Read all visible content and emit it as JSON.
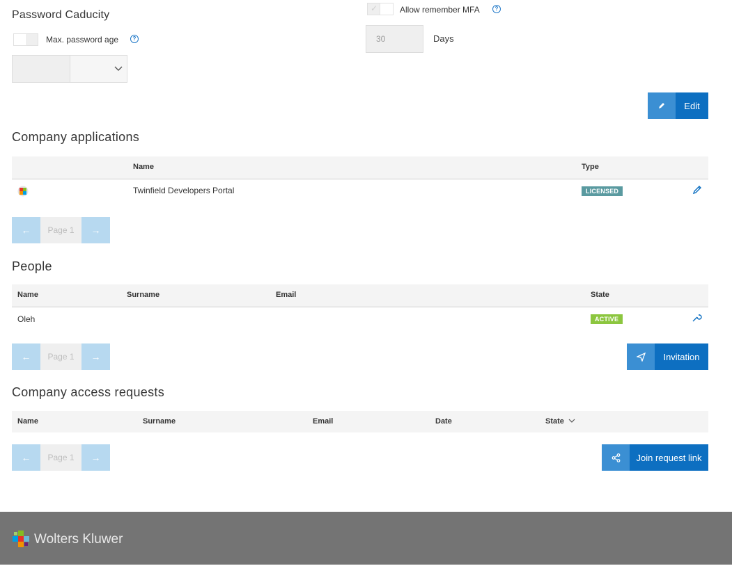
{
  "password": {
    "title": "Password Caducity",
    "max_age_label": "Max. password age",
    "help_glyph": "?"
  },
  "mfa": {
    "allow_remember_label": "Allow remember MFA",
    "days_value": "30",
    "days_label": "Days"
  },
  "edit_button": {
    "label": "Edit",
    "icon": "pencil-icon"
  },
  "company_applications": {
    "title": "Company applications",
    "columns": {
      "name": "Name",
      "type": "Type"
    },
    "rows": [
      {
        "name": "Twinfield Developers Portal",
        "type": "LICENSED"
      }
    ],
    "pager": {
      "label": "Page 1"
    }
  },
  "people": {
    "title": "People",
    "columns": {
      "name": "Name",
      "surname": "Surname",
      "email": "Email",
      "state": "State"
    },
    "rows": [
      {
        "name": "Oleh",
        "surname": "",
        "email": "",
        "state": "ACTIVE"
      }
    ],
    "pager": {
      "label": "Page 1"
    },
    "invitation_label": "Invitation"
  },
  "access_requests": {
    "title": "Company access requests",
    "columns": {
      "name": "Name",
      "surname": "Surname",
      "email": "Email",
      "date": "Date",
      "state": "State"
    },
    "pager": {
      "label": "Page 1"
    },
    "join_label": "Join request link"
  },
  "footer": {
    "brand": "Wolters Kluwer"
  },
  "colors": {
    "primary": "#0d6fc1",
    "primary_light": "#3b8fd3",
    "licensed_badge": "#5a9aa0",
    "active_badge": "#8cc63f",
    "footer_bg": "#747474"
  }
}
